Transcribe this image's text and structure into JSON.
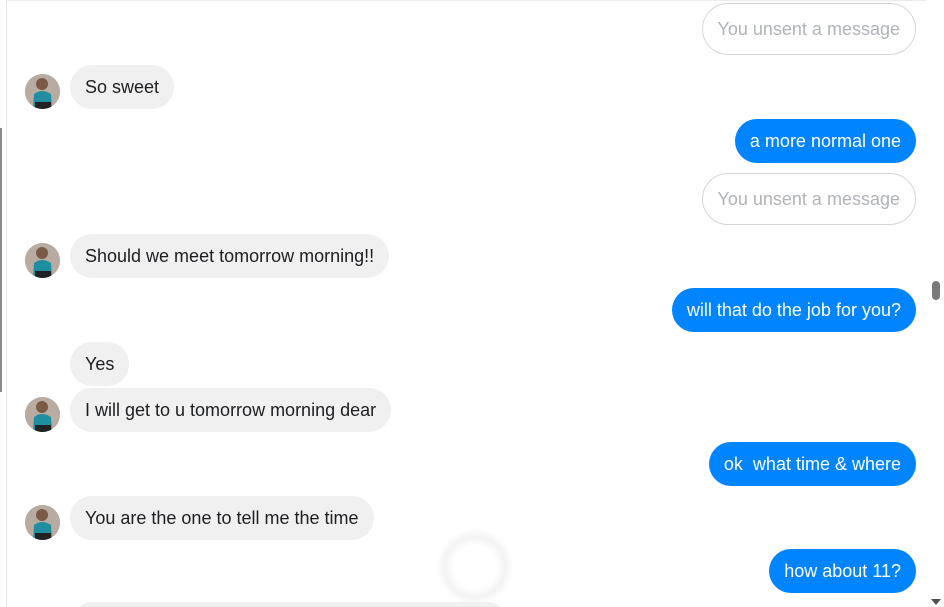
{
  "messages": {
    "m1": {
      "text": "You unsent a message"
    },
    "m2": {
      "text": "So sweet"
    },
    "m3": {
      "text": "a more normal one"
    },
    "m4": {
      "text": "You unsent a message"
    },
    "m5": {
      "text": "Should we meet tomorrow morning!!"
    },
    "m6": {
      "text": "will that do the job for you?"
    },
    "m7": {
      "text": "Yes"
    },
    "m8": {
      "text": "I will get to u tomorrow morning dear"
    },
    "m9": {
      "text": "ok  what time & where"
    },
    "m10": {
      "text": "You are the one to tell me the time"
    },
    "m11": {
      "text": "how about 11?"
    }
  },
  "colors": {
    "outgoing_bubble": "#0084ff",
    "incoming_bubble": "#f0f0f0",
    "unsent_text": "#b0b3b8"
  },
  "icons": {
    "avatar": "contact-avatar",
    "scroll_down": "chevron-down-icon"
  }
}
